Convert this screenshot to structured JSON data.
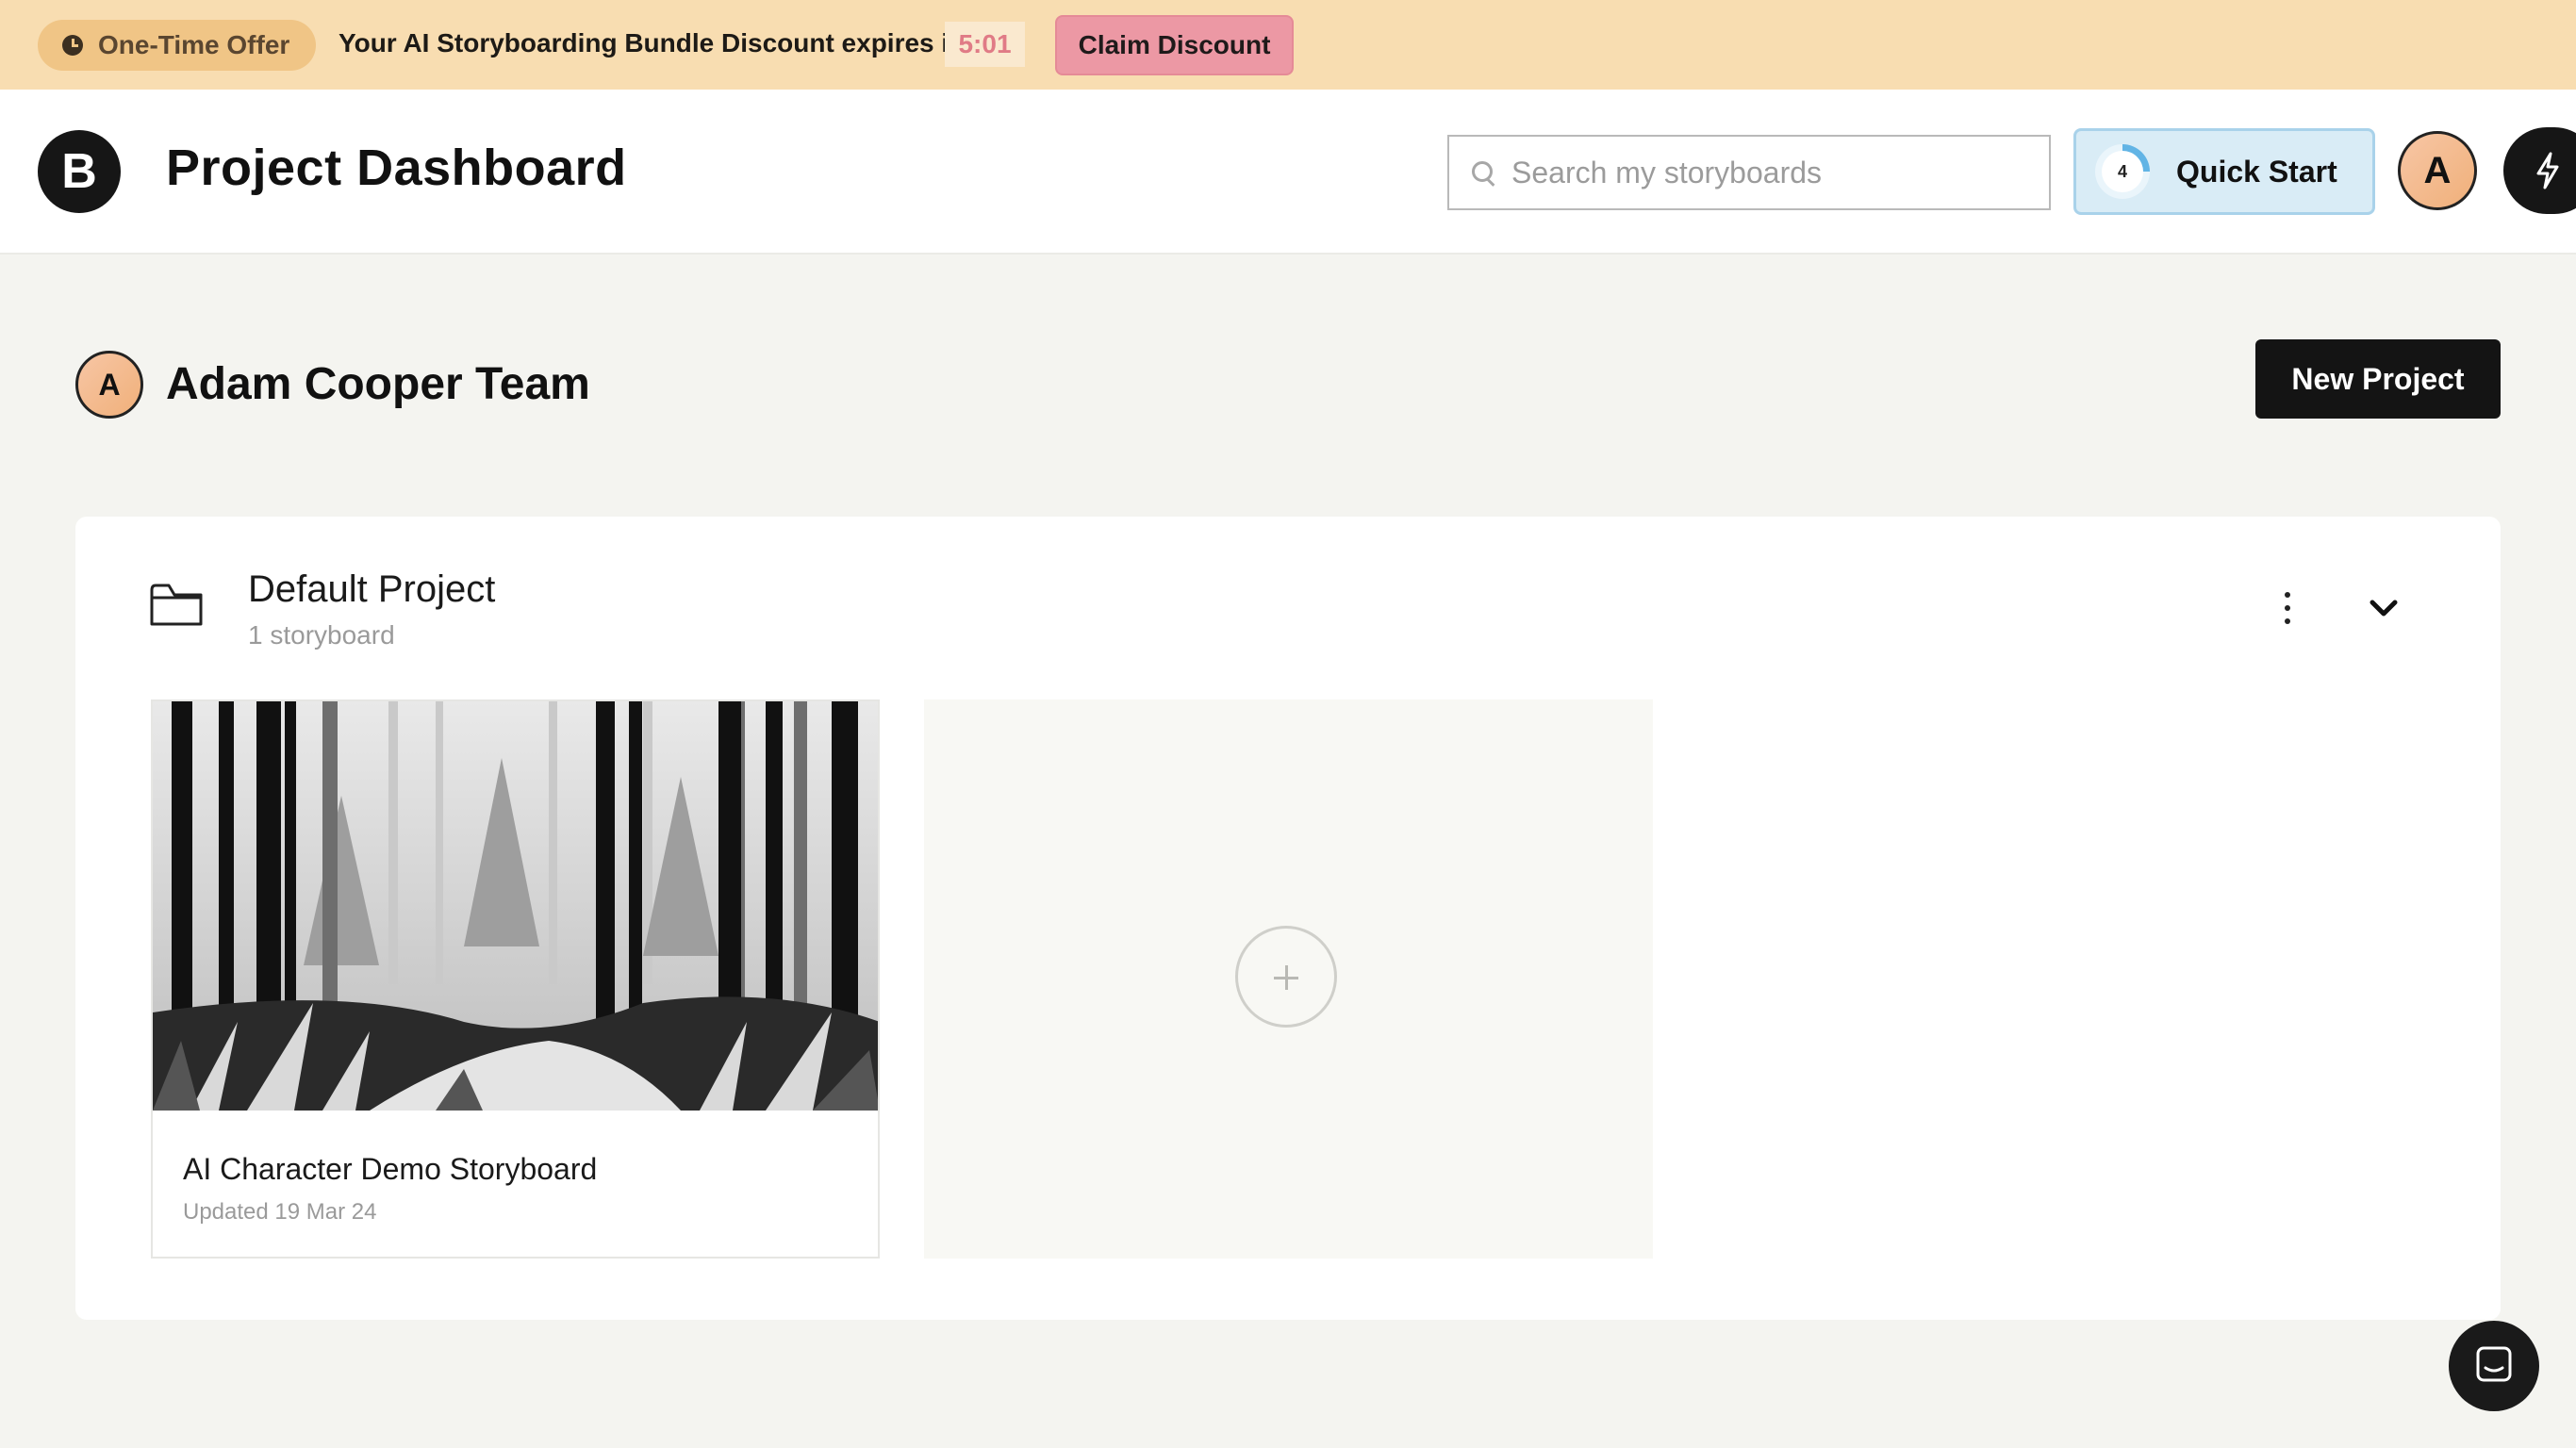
{
  "banner": {
    "offer_label": "One-Time Offer",
    "message": "Your AI Storyboarding Bundle Discount expires in",
    "timer": "5:01",
    "claim_label": "Claim Discount"
  },
  "header": {
    "logo_letter": "B",
    "title": "Project Dashboard",
    "search_placeholder": "Search my storyboards",
    "quick_start_label": "Quick Start",
    "quick_start_count": "4",
    "avatar_letter": "A"
  },
  "team": {
    "avatar_letter": "A",
    "name": "Adam Cooper Team",
    "new_project_label": "New Project"
  },
  "project": {
    "name": "Default Project",
    "count": "1 storyboard",
    "storyboards": [
      {
        "title": "AI Character Demo Storyboard",
        "updated": "Updated 19 Mar 24"
      }
    ]
  },
  "icons": {
    "clock": "clock-icon",
    "search": "search-icon",
    "bolt": "lightning-icon",
    "folder": "folder-icon",
    "more": "more-vertical-icon",
    "chevron": "chevron-down-icon",
    "add": "plus-icon",
    "chat": "chat-icon"
  },
  "colors": {
    "banner_bg": "#f8ddb1",
    "claim_bg": "#ec98a4",
    "quick_start_bg": "#d9ecf6",
    "primary_dark": "#141414"
  }
}
